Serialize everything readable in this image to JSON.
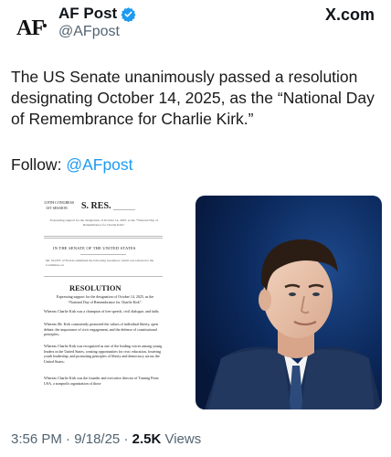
{
  "post": {
    "author_name": "AF Post",
    "author_handle": "@AFpost",
    "avatar_text": "AF",
    "platform_logo": "X.com",
    "text": "The US Senate unanimously passed a resolution designating October 14, 2025, as the “National Day of Remembrance for Charlie Kirk.”",
    "follow_label": "Follow:",
    "follow_mention": "@AFpost",
    "time": "3:56 PM",
    "date": "9/18/25",
    "views_count": "2.5K",
    "views_label": "Views"
  },
  "document": {
    "congress": "119TH CONGRESS",
    "session": "1ST SESSION",
    "res_label": "S. RES.",
    "subtitle": "Expressing support for the designation of October 14, 2025, as the “National Day of Remembrance for Charlie Kirk”.",
    "chamber": "IN THE SENATE OF THE UNITED STATES",
    "intro": "Mr. SCOTT of Florida submitted the following resolution; which was referred to the Committee on",
    "heading": "RESOLUTION",
    "purpose": "Expressing support for the designation of October 14, 2025, as the “National Day of Remembrance for Charlie Kirk”.",
    "whereas": [
      "Whereas Charlie Kirk was a champion of free speech, civil dialogue, and faith;",
      "Whereas Mr. Kirk consistently promoted the values of individual liberty, open debate, the importance of civic engagement, and the defense of constitutional principles;",
      "Whereas Charlie Kirk was recognized as one of the leading voices among young leaders in the United States, creating opportunities for civic education, fostering youth leadership, and promoting principles of liberty and democracy across the United States;",
      "Whereas Charlie Kirk was the founder and executive director of Turning Point USA, a nonprofit organization of those"
    ]
  },
  "colors": {
    "text": "#0f1419",
    "secondary": "#536471",
    "link": "#1d9bf0",
    "verified": "#1d9bf0",
    "photo_bg": "#0c2a5e"
  },
  "icons": {
    "verified": "verified-badge-icon",
    "platform": "x-logo-icon"
  }
}
